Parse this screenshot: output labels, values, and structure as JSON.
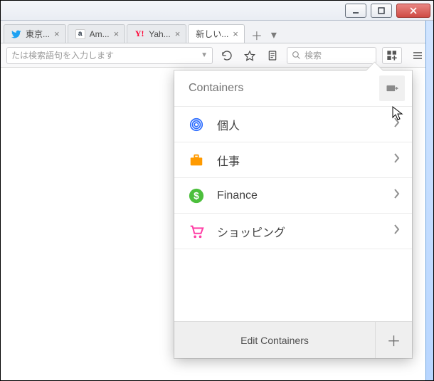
{
  "tabs": [
    {
      "label": "東京...",
      "icon": "twitter"
    },
    {
      "label": "Am...",
      "icon": "amazon"
    },
    {
      "label": "Yah...",
      "icon": "yahoo"
    },
    {
      "label": "新しい...",
      "icon": "none",
      "active": true
    }
  ],
  "urlbar": {
    "placeholder": "たは検索語句を入力します"
  },
  "searchbar": {
    "placeholder": "検索"
  },
  "panel": {
    "title": "Containers",
    "items": [
      {
        "label": "個人",
        "color": "#2b6cff",
        "icon": "fingerprint"
      },
      {
        "label": "仕事",
        "color": "#ff9a00",
        "icon": "briefcase"
      },
      {
        "label": "Finance",
        "color": "#4cbf3c",
        "icon": "dollar"
      },
      {
        "label": "ショッピング",
        "color": "#ff3fa6",
        "icon": "cart"
      }
    ],
    "footer": {
      "edit": "Edit Containers"
    }
  }
}
